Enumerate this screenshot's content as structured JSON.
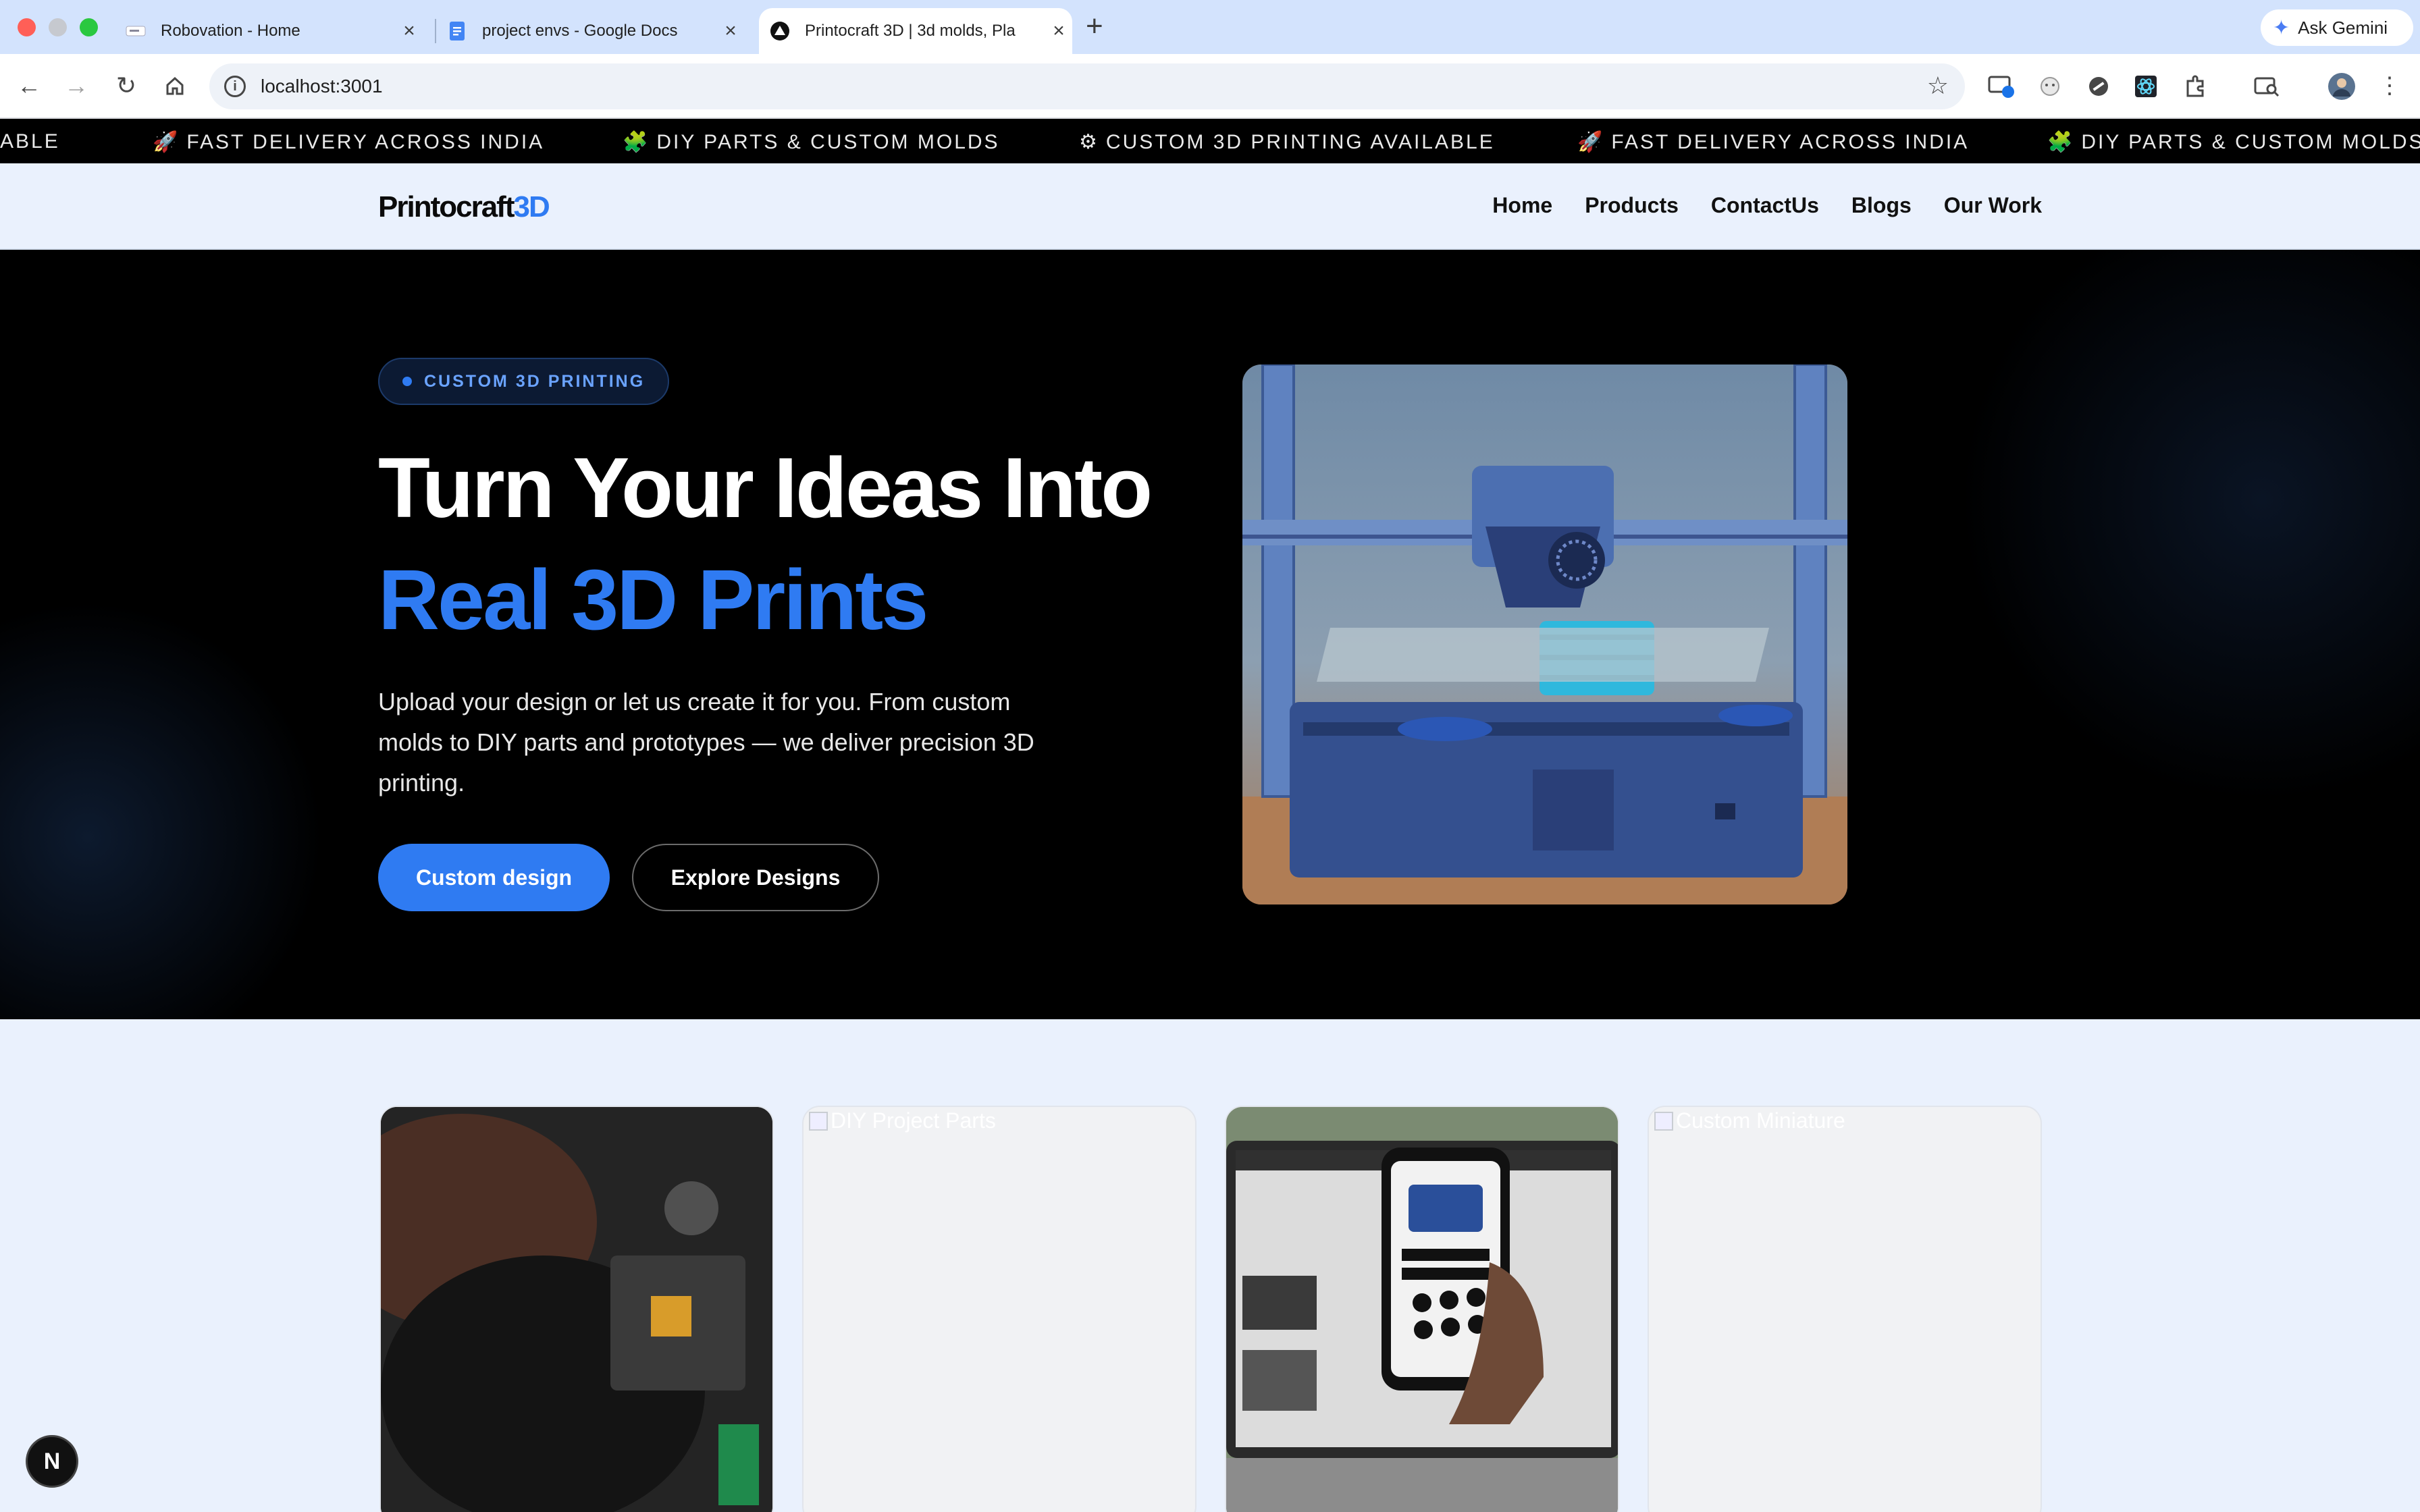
{
  "browser": {
    "tabs": [
      {
        "title": "Robovation - Home",
        "active": false
      },
      {
        "title": "project envs - Google Docs",
        "active": false
      },
      {
        "title": "Printocraft 3D | 3d molds, Pla",
        "active": true
      }
    ],
    "new_tab": "+",
    "close": "×",
    "gemini_label": "Ask Gemini",
    "url": "localhost:3001"
  },
  "ticker": {
    "items": [
      {
        "icon": "",
        "text": "ABLE"
      },
      {
        "icon": "🚀",
        "text": "FAST DELIVERY ACROSS INDIA"
      },
      {
        "icon": "🧩",
        "text": "DIY PARTS & CUSTOM MOLDS"
      },
      {
        "icon": "⚙",
        "text": "CUSTOM 3D PRINTING AVAILABLE"
      },
      {
        "icon": "🚀",
        "text": "FAST DELIVERY ACROSS INDIA"
      },
      {
        "icon": "🧩",
        "text": "DIY PARTS & CUSTOM MOLDS"
      }
    ]
  },
  "site": {
    "logo_main": "Printocraft",
    "logo_accent": "3D",
    "nav": [
      "Home",
      "Products",
      "ContactUs",
      "Blogs",
      "Our Work"
    ]
  },
  "hero": {
    "badge": "CUSTOM 3D PRINTING",
    "headline_1": "Turn Your Ideas Into",
    "headline_2": "Real 3D Prints",
    "description": "Upload your design or let us create it for you. From custom molds to DIY parts and prototypes — we deliver precision 3D printing.",
    "primary_button": "Custom design",
    "secondary_button": "Explore Designs",
    "image_subject": "3d-printer-photo"
  },
  "cards": [
    {
      "alt": "",
      "loaded": true
    },
    {
      "alt": "DIY Project Parts",
      "loaded": false
    },
    {
      "alt": "",
      "loaded": true
    },
    {
      "alt": "Custom Miniature",
      "loaded": false
    }
  ],
  "dev_badge": "N",
  "colors": {
    "accent": "#2f7bf2",
    "hero_bg": "#000000",
    "page_bg": "#eaf1fd"
  }
}
